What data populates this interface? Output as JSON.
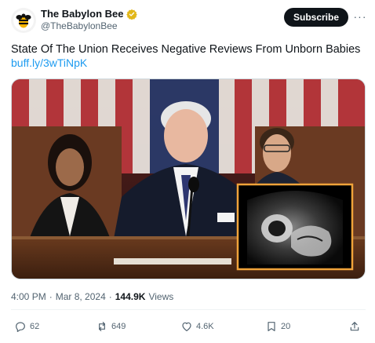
{
  "author": {
    "display_name": "The Babylon Bee",
    "handle": "@TheBabylonBee",
    "verified_badge": "gold-verified-icon",
    "avatar_icon": "bee-logo-icon"
  },
  "header": {
    "subscribe_label": "Subscribe",
    "more_label": "···"
  },
  "tweet": {
    "text": "State Of The Union Receives Negative Reviews From Unborn Babies",
    "link": "buff.ly/3wTiNpK"
  },
  "media": {
    "inset_icon": "ultrasound-image",
    "inset_border_color": "#f0a33a"
  },
  "meta": {
    "time": "4:00 PM",
    "separator": "·",
    "date": "Mar 8, 2024",
    "separator2": "·",
    "views_count": "144.9K",
    "views_label": "Views"
  },
  "actions": {
    "replies": "62",
    "reposts": "649",
    "likes": "4.6K",
    "bookmarks": "20"
  },
  "colors": {
    "accent": "#1d9bf0",
    "text": "#0f1419",
    "muted": "#536471",
    "verified_gold": "#e2b719"
  }
}
